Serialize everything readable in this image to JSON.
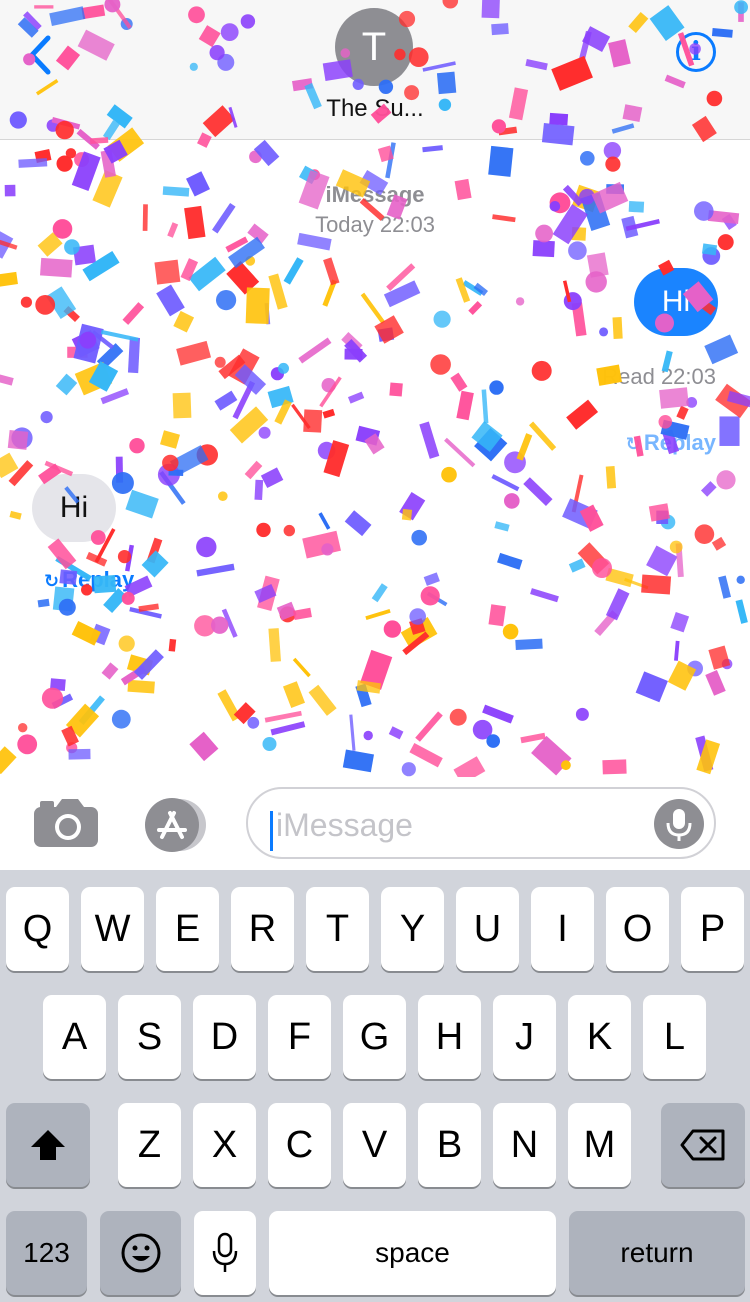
{
  "header": {
    "avatar_initial": "T",
    "contact_name": "The Su..."
  },
  "conversation": {
    "service_label": "iMessage",
    "service_time": "Today 22:03",
    "messages": [
      {
        "direction": "outgoing",
        "text": "Hi"
      },
      {
        "direction": "incoming",
        "text": "Hi"
      }
    ],
    "read_receipt": "Read 22:03",
    "replay_label": "Replay",
    "effect": "confetti"
  },
  "input_bar": {
    "placeholder": "iMessage"
  },
  "keyboard": {
    "row1": [
      "Q",
      "W",
      "E",
      "R",
      "T",
      "Y",
      "U",
      "I",
      "O",
      "P"
    ],
    "row2": [
      "A",
      "S",
      "D",
      "F",
      "G",
      "H",
      "J",
      "K",
      "L"
    ],
    "row3": [
      "Z",
      "X",
      "C",
      "V",
      "B",
      "N",
      "M"
    ],
    "numbers_label": "123",
    "space_label": "space",
    "return_label": "return"
  },
  "colors": {
    "accent": "#0a7bff",
    "outgoing_bubble": "#1a84ff",
    "incoming_bubble": "#e5e5ea",
    "keyboard_bg": "#d1d4db",
    "confetti": [
      "#8a3ffc",
      "#ff2d2d",
      "#36b7f7",
      "#e561c8",
      "#ffc20a",
      "#6f5cff",
      "#ff4f9a",
      "#2e6ff5"
    ]
  },
  "icons": [
    "back-chevron-icon",
    "info-icon",
    "camera-icon",
    "app-store-icon",
    "microphone-icon",
    "shift-icon",
    "backspace-icon",
    "emoji-icon",
    "dictation-mic-icon",
    "replay-icon"
  ]
}
